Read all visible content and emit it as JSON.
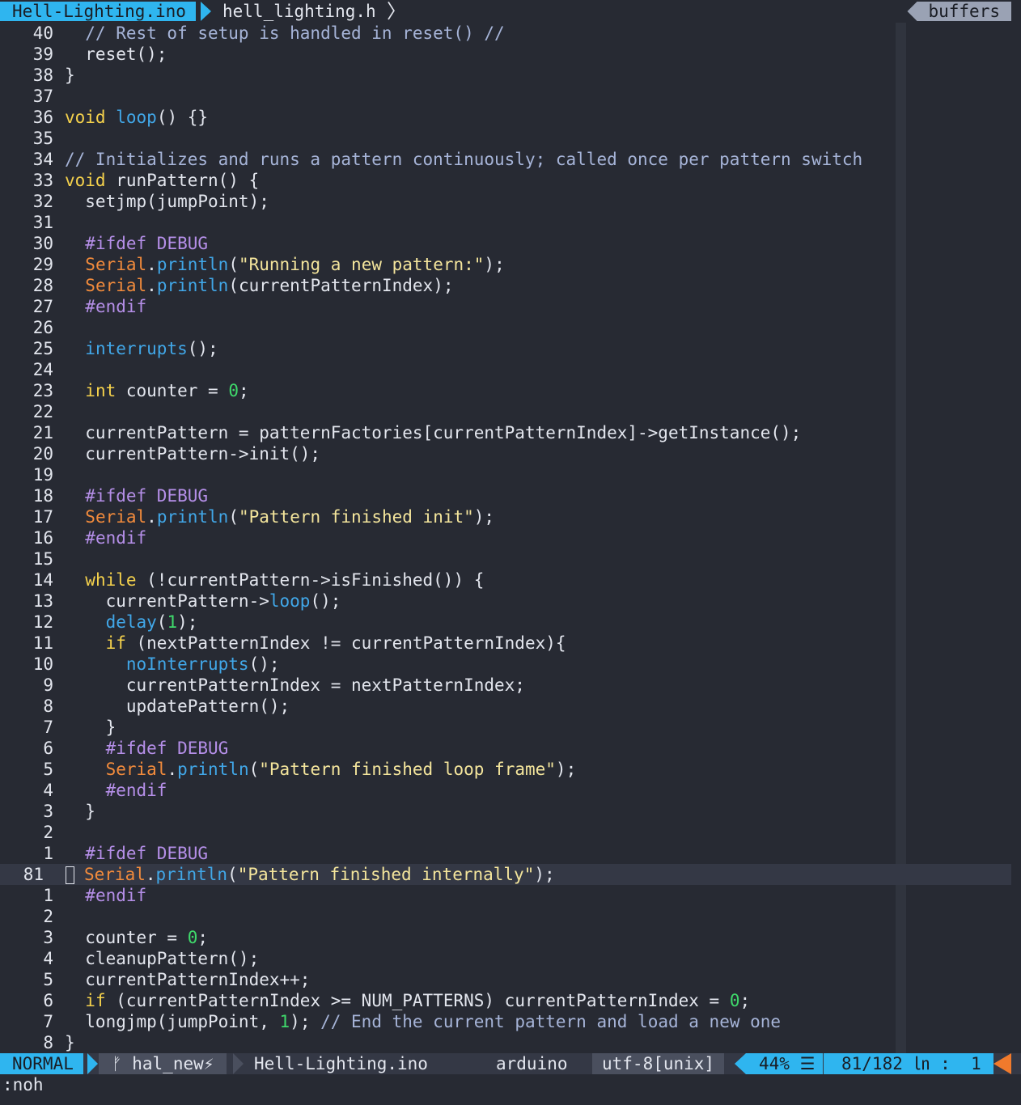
{
  "tabline": {
    "active_tab": "Hell-Lighting.ino",
    "inactive_tab": "hell_lighting.h",
    "separator": "〉",
    "buffers_label": "buffers"
  },
  "editor": {
    "lines": [
      {
        "n": "40",
        "t": [
          [
            "cm",
            "  // Rest of setup is handled in reset() //"
          ]
        ]
      },
      {
        "n": "39",
        "t": [
          [
            "",
            "  reset();"
          ]
        ]
      },
      {
        "n": "38",
        "t": [
          [
            "",
            "}"
          ]
        ]
      },
      {
        "n": "37",
        "t": []
      },
      {
        "n": "36",
        "t": [
          [
            "kw",
            "void"
          ],
          [
            "",
            " "
          ],
          [
            "fn",
            "loop"
          ],
          [
            "",
            "() {}"
          ]
        ]
      },
      {
        "n": "35",
        "t": []
      },
      {
        "n": "34",
        "t": [
          [
            "cm",
            "// Initializes and runs a pattern continuously; called once per pattern switch"
          ]
        ]
      },
      {
        "n": "33",
        "t": [
          [
            "kw",
            "void"
          ],
          [
            "",
            " runPattern() {"
          ]
        ]
      },
      {
        "n": "32",
        "t": [
          [
            "",
            "  setjmp(jumpPoint);"
          ]
        ]
      },
      {
        "n": "31",
        "t": []
      },
      {
        "n": "30",
        "t": [
          [
            "",
            "  "
          ],
          [
            "pp",
            "#ifdef DEBUG"
          ]
        ]
      },
      {
        "n": "29",
        "t": [
          [
            "",
            "  "
          ],
          [
            "cls",
            "Serial"
          ],
          [
            "",
            "."
          ],
          [
            "fn",
            "println"
          ],
          [
            "",
            "("
          ],
          [
            "str",
            "\"Running a new pattern:\""
          ],
          [
            "",
            ");"
          ]
        ]
      },
      {
        "n": "28",
        "t": [
          [
            "",
            "  "
          ],
          [
            "cls",
            "Serial"
          ],
          [
            "",
            "."
          ],
          [
            "fn",
            "println"
          ],
          [
            "",
            "(currentPatternIndex);"
          ]
        ]
      },
      {
        "n": "27",
        "t": [
          [
            "",
            "  "
          ],
          [
            "pp",
            "#endif"
          ]
        ]
      },
      {
        "n": "26",
        "t": []
      },
      {
        "n": "25",
        "t": [
          [
            "",
            "  "
          ],
          [
            "fn",
            "interrupts"
          ],
          [
            "",
            "();"
          ]
        ]
      },
      {
        "n": "24",
        "t": []
      },
      {
        "n": "23",
        "t": [
          [
            "",
            "  "
          ],
          [
            "kw",
            "int"
          ],
          [
            "",
            " counter = "
          ],
          [
            "num",
            "0"
          ],
          [
            "",
            ";"
          ]
        ]
      },
      {
        "n": "22",
        "t": []
      },
      {
        "n": "21",
        "t": [
          [
            "",
            "  currentPattern = patternFactories[currentPatternIndex]->getInstance();"
          ]
        ]
      },
      {
        "n": "20",
        "t": [
          [
            "",
            "  currentPattern->init();"
          ]
        ]
      },
      {
        "n": "19",
        "t": []
      },
      {
        "n": "18",
        "t": [
          [
            "",
            "  "
          ],
          [
            "pp",
            "#ifdef DEBUG"
          ]
        ]
      },
      {
        "n": "17",
        "t": [
          [
            "",
            "  "
          ],
          [
            "cls",
            "Serial"
          ],
          [
            "",
            "."
          ],
          [
            "fn",
            "println"
          ],
          [
            "",
            "("
          ],
          [
            "str",
            "\"Pattern finished init\""
          ],
          [
            "",
            ");"
          ]
        ]
      },
      {
        "n": "16",
        "t": [
          [
            "",
            "  "
          ],
          [
            "pp",
            "#endif"
          ]
        ]
      },
      {
        "n": "15",
        "t": []
      },
      {
        "n": "14",
        "t": [
          [
            "",
            "  "
          ],
          [
            "kw",
            "while"
          ],
          [
            "",
            " (!currentPattern->isFinished()) {"
          ]
        ]
      },
      {
        "n": "13",
        "t": [
          [
            "",
            "    currentPattern->"
          ],
          [
            "fn",
            "loop"
          ],
          [
            "",
            "();"
          ]
        ]
      },
      {
        "n": "12",
        "t": [
          [
            "",
            "    "
          ],
          [
            "fn",
            "delay"
          ],
          [
            "",
            "("
          ],
          [
            "num",
            "1"
          ],
          [
            "",
            ");"
          ]
        ]
      },
      {
        "n": "11",
        "t": [
          [
            "",
            "    "
          ],
          [
            "kw",
            "if"
          ],
          [
            "",
            " (nextPatternIndex != currentPatternIndex){"
          ]
        ]
      },
      {
        "n": "10",
        "t": [
          [
            "",
            "      "
          ],
          [
            "fn",
            "noInterrupts"
          ],
          [
            "",
            "();"
          ]
        ]
      },
      {
        "n": "9",
        "t": [
          [
            "",
            "      currentPatternIndex = nextPatternIndex;"
          ]
        ]
      },
      {
        "n": "8",
        "t": [
          [
            "",
            "      updatePattern();"
          ]
        ]
      },
      {
        "n": "7",
        "t": [
          [
            "",
            "    }"
          ]
        ]
      },
      {
        "n": "6",
        "t": [
          [
            "",
            "    "
          ],
          [
            "pp",
            "#ifdef DEBUG"
          ]
        ]
      },
      {
        "n": "5",
        "t": [
          [
            "",
            "    "
          ],
          [
            "cls",
            "Serial"
          ],
          [
            "",
            "."
          ],
          [
            "fn",
            "println"
          ],
          [
            "",
            "("
          ],
          [
            "str",
            "\"Pattern finished loop frame\""
          ],
          [
            "",
            ");"
          ]
        ]
      },
      {
        "n": "4",
        "t": [
          [
            "",
            "    "
          ],
          [
            "pp",
            "#endif"
          ]
        ]
      },
      {
        "n": "3",
        "t": [
          [
            "",
            "  }"
          ]
        ]
      },
      {
        "n": "2",
        "t": []
      },
      {
        "n": "1",
        "t": [
          [
            "",
            "  "
          ],
          [
            "pp",
            "#ifdef DEBUG"
          ]
        ]
      },
      {
        "n": "81",
        "cur": true,
        "t": [
          [
            "cls",
            "Serial"
          ],
          [
            "",
            "."
          ],
          [
            "fn",
            "println"
          ],
          [
            "",
            "("
          ],
          [
            "str",
            "\"Pattern finished internally\""
          ],
          [
            "",
            ");"
          ]
        ]
      },
      {
        "n": "1",
        "t": [
          [
            "",
            "  "
          ],
          [
            "pp",
            "#endif"
          ]
        ]
      },
      {
        "n": "2",
        "t": []
      },
      {
        "n": "3",
        "t": [
          [
            "",
            "  counter = "
          ],
          [
            "num",
            "0"
          ],
          [
            "",
            ";"
          ]
        ]
      },
      {
        "n": "4",
        "t": [
          [
            "",
            "  cleanupPattern();"
          ]
        ]
      },
      {
        "n": "5",
        "t": [
          [
            "",
            "  currentPatternIndex++;"
          ]
        ]
      },
      {
        "n": "6",
        "t": [
          [
            "",
            "  "
          ],
          [
            "kw",
            "if"
          ],
          [
            "",
            " (currentPatternIndex >= NUM_PATTERNS) currentPatternIndex = "
          ],
          [
            "num",
            "0"
          ],
          [
            "",
            ";"
          ]
        ]
      },
      {
        "n": "7",
        "t": [
          [
            "",
            "  longjmp(jumpPoint, "
          ],
          [
            "num",
            "1"
          ],
          [
            "",
            "); "
          ],
          [
            "cm",
            "// End the current pattern and load a new one"
          ]
        ]
      },
      {
        "n": "8",
        "t": [
          [
            "",
            "}"
          ]
        ]
      }
    ]
  },
  "statusline": {
    "mode": "NORMAL",
    "branch": "ᚠ hal_new⚡",
    "filename": "Hell-Lighting.ino",
    "filetype": "arduino",
    "encoding": "utf-8[unix]",
    "percent": "44% ☰",
    "position": "81/182 ㏑ :  1"
  },
  "cmdline": {
    "text": ":noh"
  },
  "colors": {
    "background": "#272a33",
    "accent_blue": "#2fb5ef",
    "warning_orange": "#f07a2c",
    "comment": "#a6b4d8",
    "keyword": "#f4d14c",
    "function": "#41a7e8",
    "preproc": "#b58fe8",
    "class": "#f28b3c",
    "string": "#f4e59c",
    "number": "#3fd96b"
  }
}
